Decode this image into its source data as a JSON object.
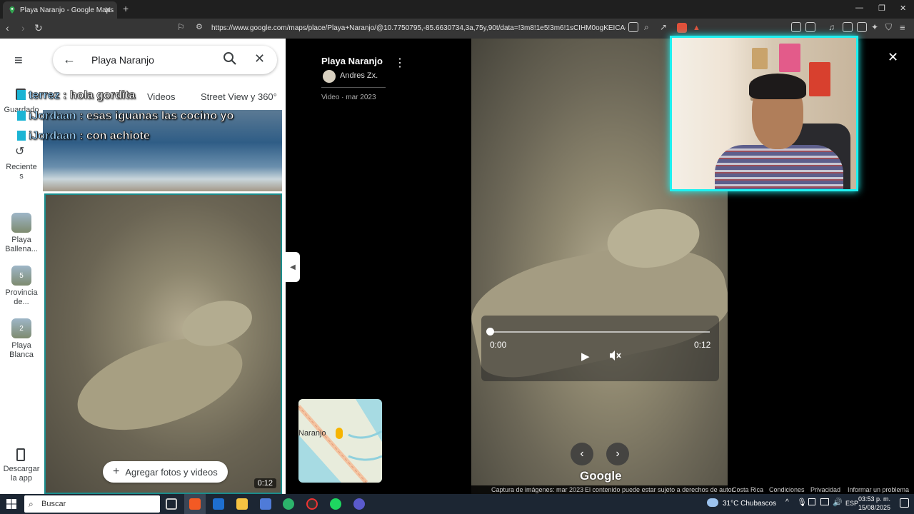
{
  "browser": {
    "tab_title": "Playa Naranjo - Google Maps",
    "new_tab_symbol": "+",
    "url": "https://www.google.com/maps/place/Playa+Naranjo/@10.7750795,-85.6630734,3a,75y,90t/data=!3m8!1e5!3m6!1sCIHM0ogKEICAgICR8Y..."
  },
  "rail": {
    "saved_label": "Guardado",
    "recent_label": "Recientes",
    "items": [
      {
        "label": "Playa Ballena...",
        "badge": ""
      },
      {
        "label": "Provincia de...",
        "badge": "5"
      },
      {
        "label": "Playa Blanca",
        "badge": "2"
      }
    ],
    "download_label": "Descargar la app"
  },
  "panel": {
    "search_value": "Playa Naranjo",
    "tabs": [
      "Videos",
      "Street View y 360°"
    ],
    "duration": "0:12",
    "add_photos_label": "Agregar fotos y videos"
  },
  "chat": [
    {
      "user": "terrez",
      "message": "hola gordita"
    },
    {
      "user": "iJordaan",
      "message": "esas iguanas las cocino yo"
    },
    {
      "user": "iJordaan",
      "message": "con achiote"
    }
  ],
  "viewer": {
    "place_title": "Playa Naranjo",
    "author": "Andres Zx.",
    "meta": "Video · mar 2023",
    "minimap_label": "Naranjo",
    "time_current": "0:00",
    "time_total": "0:12",
    "progress": 0,
    "watermark": "Google"
  },
  "footer": {
    "capture": "Captura de imágenes: mar 2023",
    "rights": "El contenido puede estar sujeto a derechos de autor.",
    "country": "Costa Rica",
    "terms": "Condiciones",
    "privacy": "Privacidad",
    "report": "Informar un problema"
  },
  "taskbar": {
    "search_placeholder": "Buscar",
    "weather": "31°C  Chubascos",
    "lang": "ESP",
    "time": "03:53 p. m.",
    "date": "15/08/2025"
  },
  "colors": {
    "webcam_border": "#1ff0f0",
    "panel_highlight": "#1a8d8d"
  }
}
